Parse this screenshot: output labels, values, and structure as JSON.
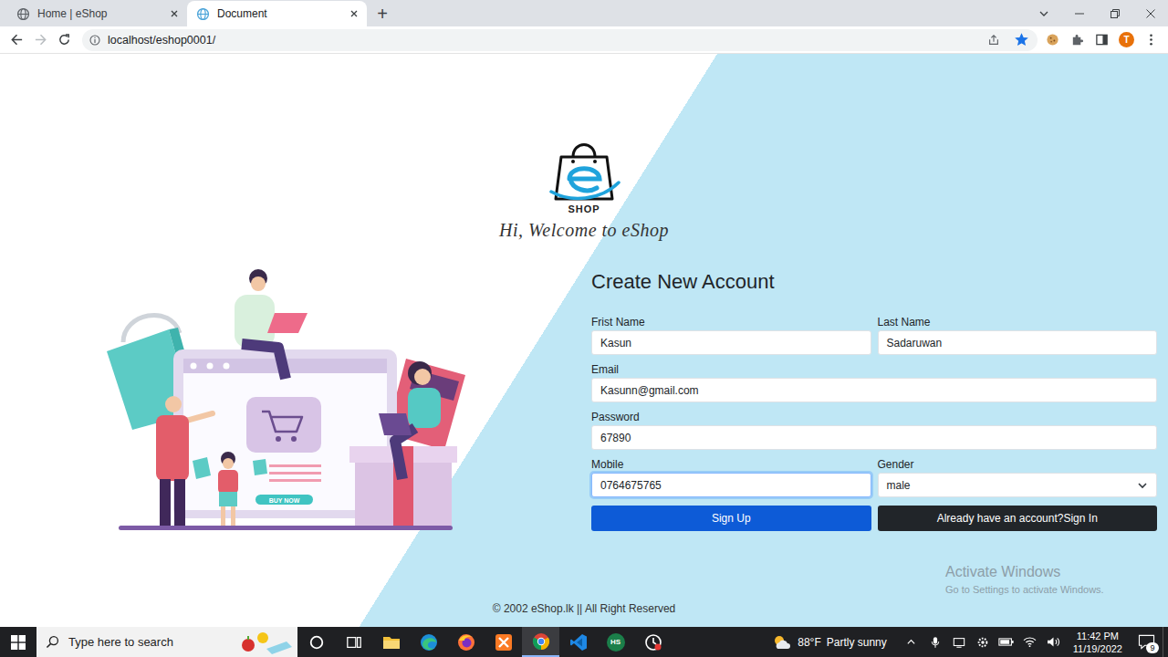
{
  "browser": {
    "tabs": [
      {
        "title": "Home | eShop",
        "selected": false
      },
      {
        "title": "Document",
        "selected": true
      }
    ],
    "new_tab": "+",
    "address": "localhost/eshop0001/",
    "back_enabled": true,
    "forward_enabled": false,
    "bookmarked": true,
    "profile": "T"
  },
  "page": {
    "logo": {
      "text": "SHOP",
      "tagline": "Hi, Welcome to eShop"
    },
    "illustration": {
      "button": "BUY NOW"
    },
    "form": {
      "title": "Create New Account",
      "rows": [
        [
          {
            "label": "Frist Name",
            "value": "Kasun",
            "kind": "text",
            "focused": false
          },
          {
            "label": "Last Name",
            "value": "Sadaruwan",
            "kind": "text",
            "focused": false
          }
        ],
        [
          {
            "label": "Email",
            "value": "Kasunn@gmail.com",
            "kind": "text",
            "focused": false
          }
        ],
        [
          {
            "label": "Password",
            "value": "67890",
            "kind": "text",
            "focused": false
          }
        ],
        [
          {
            "label": "Mobile",
            "value": "0764675765",
            "kind": "text",
            "focused": true
          },
          {
            "label": "Gender",
            "value": "male",
            "kind": "select",
            "focused": false
          }
        ]
      ],
      "buttons": [
        {
          "label": "Sign Up",
          "kind": "primary"
        },
        {
          "label": "Already have an account?Sign In",
          "kind": "dark"
        }
      ]
    },
    "footer": "© 2002 eShop.lk || All Right Reserved"
  },
  "watermark": {
    "title": "Activate Windows",
    "subtitle": "Go to Settings to activate Windows."
  },
  "taskbar": {
    "search_placeholder": "Type here to search",
    "apps": [
      {
        "kind": "cortana",
        "selected": false
      },
      {
        "kind": "taskview",
        "selected": false
      },
      {
        "kind": "explorer",
        "selected": false
      },
      {
        "kind": "edge",
        "selected": false
      },
      {
        "kind": "firefox",
        "selected": false
      },
      {
        "kind": "xampp",
        "selected": false
      },
      {
        "kind": "chrome",
        "selected": true
      },
      {
        "kind": "vscode",
        "selected": false
      },
      {
        "kind": "hs",
        "selected": false,
        "text": "HS"
      },
      {
        "kind": "clock",
        "selected": false
      }
    ],
    "weather": {
      "temp": "88°F",
      "text": "Partly sunny"
    },
    "clock": {
      "time": "11:42 PM",
      "date": "11/19/2022"
    },
    "notifications": "9"
  }
}
